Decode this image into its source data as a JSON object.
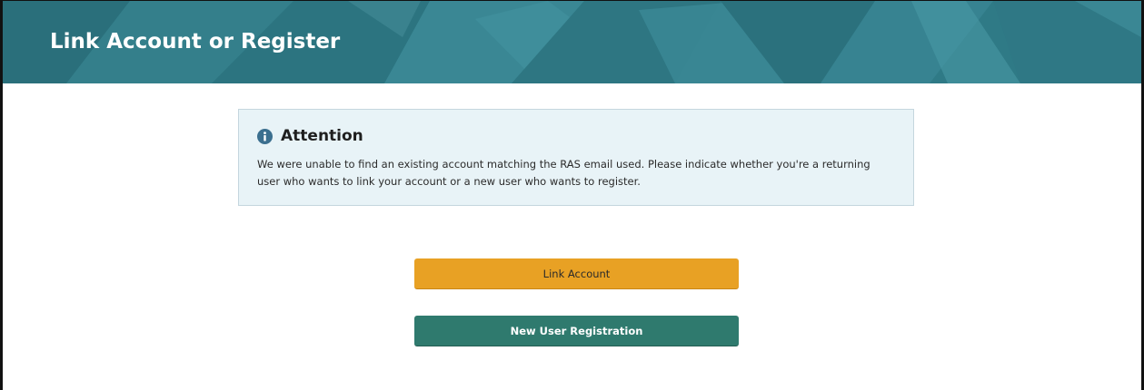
{
  "header": {
    "title": "Link Account or Register",
    "background_color": "#2f7a86"
  },
  "alert": {
    "icon": "info-circle-icon",
    "title": "Attention",
    "message": "We were unable to find an existing account matching the RAS email used. Please indicate whether you're a returning user who wants to link your account or a new user who wants to register.",
    "background_color": "#e8f3f7",
    "icon_color": "#3b6f8f"
  },
  "actions": {
    "link_account_label": "Link Account",
    "link_account_color": "#e8a124",
    "new_user_label": "New User Registration",
    "new_user_color": "#2f7a6e"
  }
}
